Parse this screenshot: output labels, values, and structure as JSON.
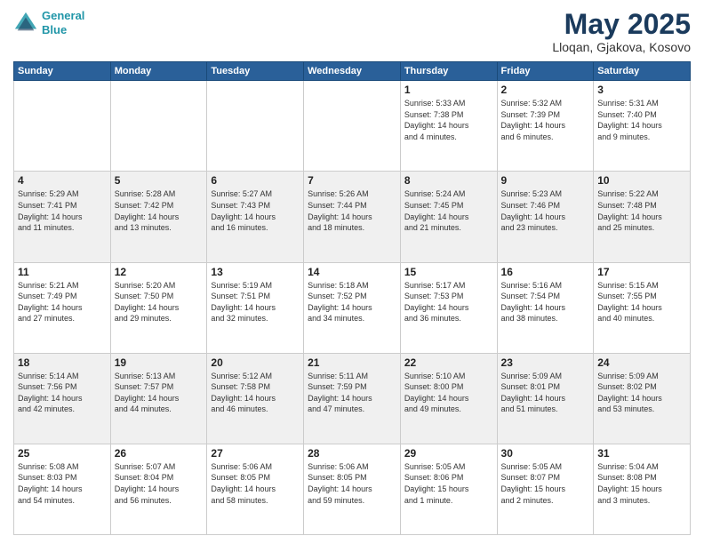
{
  "header": {
    "logo_line1": "General",
    "logo_line2": "Blue",
    "month": "May 2025",
    "location": "Lloqan, Gjakova, Kosovo"
  },
  "days_of_week": [
    "Sunday",
    "Monday",
    "Tuesday",
    "Wednesday",
    "Thursday",
    "Friday",
    "Saturday"
  ],
  "weeks": [
    [
      {
        "num": "",
        "info": ""
      },
      {
        "num": "",
        "info": ""
      },
      {
        "num": "",
        "info": ""
      },
      {
        "num": "",
        "info": ""
      },
      {
        "num": "1",
        "info": "Sunrise: 5:33 AM\nSunset: 7:38 PM\nDaylight: 14 hours\nand 4 minutes."
      },
      {
        "num": "2",
        "info": "Sunrise: 5:32 AM\nSunset: 7:39 PM\nDaylight: 14 hours\nand 6 minutes."
      },
      {
        "num": "3",
        "info": "Sunrise: 5:31 AM\nSunset: 7:40 PM\nDaylight: 14 hours\nand 9 minutes."
      }
    ],
    [
      {
        "num": "4",
        "info": "Sunrise: 5:29 AM\nSunset: 7:41 PM\nDaylight: 14 hours\nand 11 minutes."
      },
      {
        "num": "5",
        "info": "Sunrise: 5:28 AM\nSunset: 7:42 PM\nDaylight: 14 hours\nand 13 minutes."
      },
      {
        "num": "6",
        "info": "Sunrise: 5:27 AM\nSunset: 7:43 PM\nDaylight: 14 hours\nand 16 minutes."
      },
      {
        "num": "7",
        "info": "Sunrise: 5:26 AM\nSunset: 7:44 PM\nDaylight: 14 hours\nand 18 minutes."
      },
      {
        "num": "8",
        "info": "Sunrise: 5:24 AM\nSunset: 7:45 PM\nDaylight: 14 hours\nand 21 minutes."
      },
      {
        "num": "9",
        "info": "Sunrise: 5:23 AM\nSunset: 7:46 PM\nDaylight: 14 hours\nand 23 minutes."
      },
      {
        "num": "10",
        "info": "Sunrise: 5:22 AM\nSunset: 7:48 PM\nDaylight: 14 hours\nand 25 minutes."
      }
    ],
    [
      {
        "num": "11",
        "info": "Sunrise: 5:21 AM\nSunset: 7:49 PM\nDaylight: 14 hours\nand 27 minutes."
      },
      {
        "num": "12",
        "info": "Sunrise: 5:20 AM\nSunset: 7:50 PM\nDaylight: 14 hours\nand 29 minutes."
      },
      {
        "num": "13",
        "info": "Sunrise: 5:19 AM\nSunset: 7:51 PM\nDaylight: 14 hours\nand 32 minutes."
      },
      {
        "num": "14",
        "info": "Sunrise: 5:18 AM\nSunset: 7:52 PM\nDaylight: 14 hours\nand 34 minutes."
      },
      {
        "num": "15",
        "info": "Sunrise: 5:17 AM\nSunset: 7:53 PM\nDaylight: 14 hours\nand 36 minutes."
      },
      {
        "num": "16",
        "info": "Sunrise: 5:16 AM\nSunset: 7:54 PM\nDaylight: 14 hours\nand 38 minutes."
      },
      {
        "num": "17",
        "info": "Sunrise: 5:15 AM\nSunset: 7:55 PM\nDaylight: 14 hours\nand 40 minutes."
      }
    ],
    [
      {
        "num": "18",
        "info": "Sunrise: 5:14 AM\nSunset: 7:56 PM\nDaylight: 14 hours\nand 42 minutes."
      },
      {
        "num": "19",
        "info": "Sunrise: 5:13 AM\nSunset: 7:57 PM\nDaylight: 14 hours\nand 44 minutes."
      },
      {
        "num": "20",
        "info": "Sunrise: 5:12 AM\nSunset: 7:58 PM\nDaylight: 14 hours\nand 46 minutes."
      },
      {
        "num": "21",
        "info": "Sunrise: 5:11 AM\nSunset: 7:59 PM\nDaylight: 14 hours\nand 47 minutes."
      },
      {
        "num": "22",
        "info": "Sunrise: 5:10 AM\nSunset: 8:00 PM\nDaylight: 14 hours\nand 49 minutes."
      },
      {
        "num": "23",
        "info": "Sunrise: 5:09 AM\nSunset: 8:01 PM\nDaylight: 14 hours\nand 51 minutes."
      },
      {
        "num": "24",
        "info": "Sunrise: 5:09 AM\nSunset: 8:02 PM\nDaylight: 14 hours\nand 53 minutes."
      }
    ],
    [
      {
        "num": "25",
        "info": "Sunrise: 5:08 AM\nSunset: 8:03 PM\nDaylight: 14 hours\nand 54 minutes."
      },
      {
        "num": "26",
        "info": "Sunrise: 5:07 AM\nSunset: 8:04 PM\nDaylight: 14 hours\nand 56 minutes."
      },
      {
        "num": "27",
        "info": "Sunrise: 5:06 AM\nSunset: 8:05 PM\nDaylight: 14 hours\nand 58 minutes."
      },
      {
        "num": "28",
        "info": "Sunrise: 5:06 AM\nSunset: 8:05 PM\nDaylight: 14 hours\nand 59 minutes."
      },
      {
        "num": "29",
        "info": "Sunrise: 5:05 AM\nSunset: 8:06 PM\nDaylight: 15 hours\nand 1 minute."
      },
      {
        "num": "30",
        "info": "Sunrise: 5:05 AM\nSunset: 8:07 PM\nDaylight: 15 hours\nand 2 minutes."
      },
      {
        "num": "31",
        "info": "Sunrise: 5:04 AM\nSunset: 8:08 PM\nDaylight: 15 hours\nand 3 minutes."
      }
    ]
  ]
}
